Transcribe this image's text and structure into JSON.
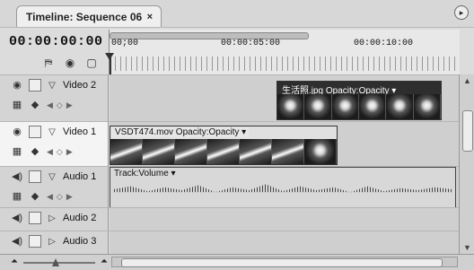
{
  "panel": {
    "title": "Timeline: Sequence 06",
    "close_glyph": "×",
    "menu_glyph": "▸"
  },
  "timecode": "00:00:00:00",
  "toolbar": {
    "icons": [
      "snap-icon",
      "marker-icon",
      "keyframe-icon"
    ]
  },
  "ruler": {
    "labels": [
      "00;00",
      "00:00:05:00",
      "00:00:10:00"
    ]
  },
  "tracks": {
    "video2": {
      "name": "Video 2",
      "clip_label": "生活照.jpg Opacity:Opacity ▾"
    },
    "video1": {
      "name": "Video 1",
      "clip_label": "VSDT474.mov Opacity:Opacity ▾"
    },
    "audio1": {
      "name": "Audio 1",
      "clip_label": "Track:Volume ▾"
    },
    "audio2": {
      "name": "Audio 2"
    },
    "audio3": {
      "name": "Audio 3"
    }
  },
  "colors": {
    "panel_bg": "#dcdcdc",
    "active_track": "#f4f4f4",
    "clip_dark": "#2e2e2e"
  }
}
